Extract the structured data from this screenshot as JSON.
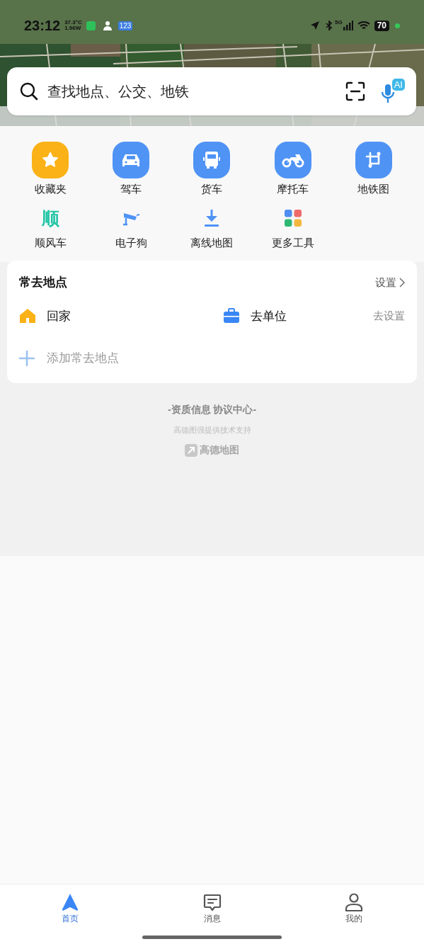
{
  "status_bar": {
    "time": "23:12",
    "temperature": "37.3°C",
    "power": "1.96W",
    "badge": "123",
    "network": "5G",
    "battery": "70"
  },
  "search": {
    "placeholder": "查找地点、公交、地铁",
    "ai_badge": "AI"
  },
  "tools": [
    {
      "label": "收藏夹",
      "kind": "tile"
    },
    {
      "label": "驾车",
      "kind": "tile"
    },
    {
      "label": "货车",
      "kind": "tile"
    },
    {
      "label": "摩托车",
      "kind": "tile"
    },
    {
      "label": "地铁图",
      "kind": "tile"
    },
    {
      "label": "顺风车",
      "kind": "glyph",
      "glyph": "顺"
    },
    {
      "label": "电子狗",
      "kind": "glyph"
    },
    {
      "label": "离线地图",
      "kind": "glyph"
    },
    {
      "label": "更多工具",
      "kind": "glyph"
    }
  ],
  "frequent_places": {
    "title": "常去地点",
    "settings": "设置",
    "home": "回家",
    "work": "去单位",
    "work_action": "去设置",
    "add": "添加常去地点"
  },
  "footer": {
    "links": "-资质信息 协议中心-",
    "support": "高德图强提供技术支持",
    "logo_text": "高德地图"
  },
  "nav": [
    {
      "label": "首页",
      "selected": true
    },
    {
      "label": "消息",
      "selected": false
    },
    {
      "label": "我的",
      "selected": false
    }
  ]
}
